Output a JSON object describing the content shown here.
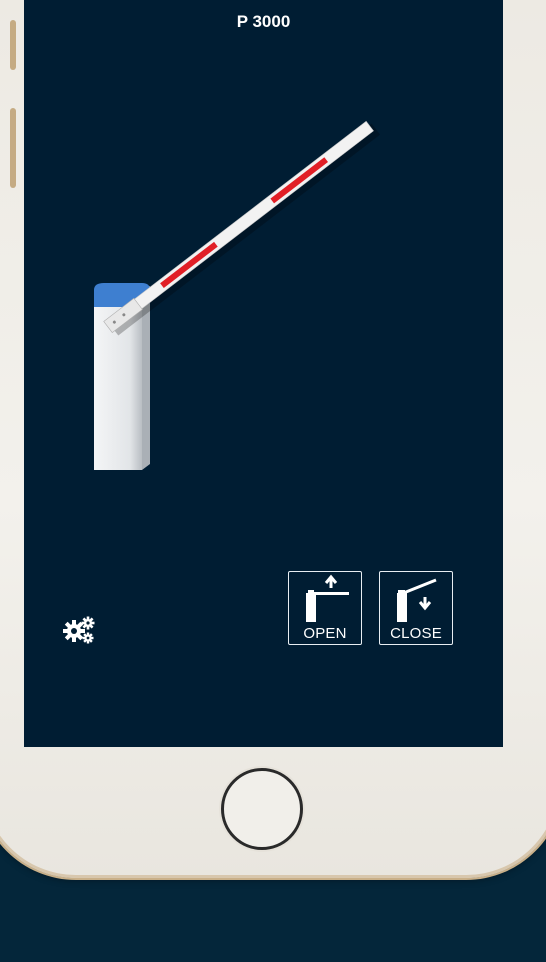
{
  "device": {
    "frame_color": "#f1efe9",
    "accent": "#c5ab83",
    "background": "#04263a"
  },
  "app": {
    "title": "P 3000",
    "screen_color": "#001d33",
    "barrier": {
      "boom_stripe_color": "#e11f26",
      "cap_color": "#3e7fd0",
      "position": "open"
    },
    "buttons": {
      "open_label": "OPEN",
      "close_label": "CLOSE"
    },
    "settings_icon": "gears-icon"
  },
  "icons": {
    "open": "barrier-open-icon",
    "close": "barrier-close-icon",
    "home": "home-button"
  }
}
